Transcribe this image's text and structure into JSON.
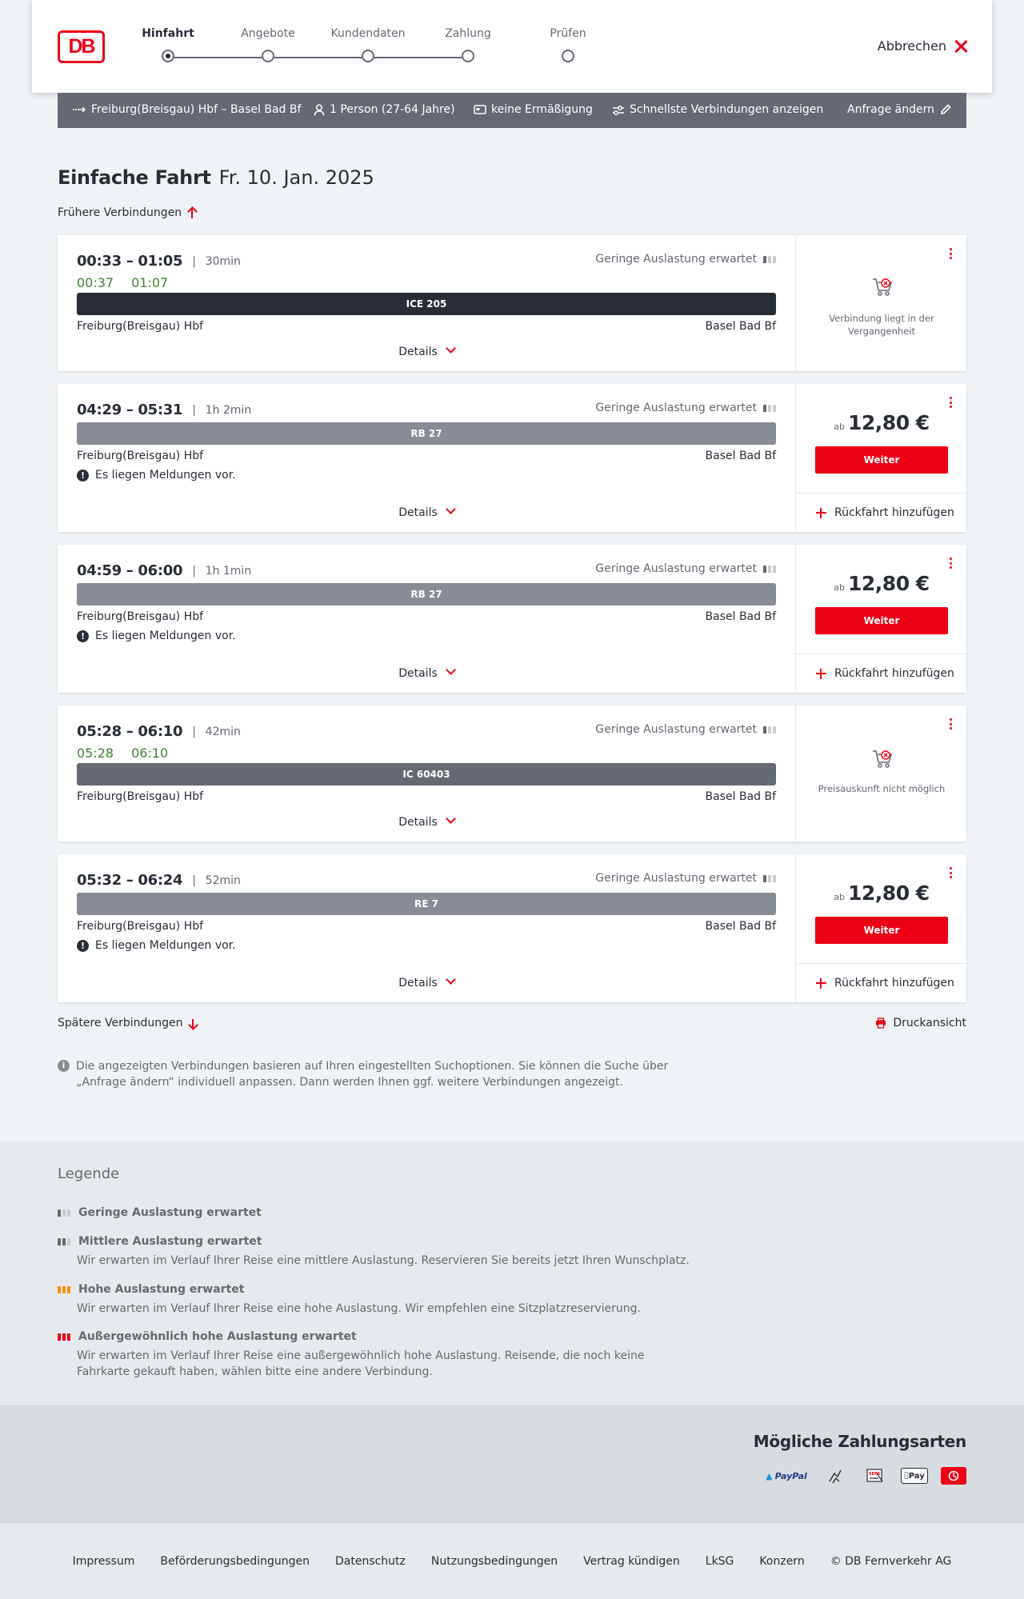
{
  "header": {
    "logo": "DB",
    "steps": [
      "Hinfahrt",
      "Angebote",
      "Kundendaten",
      "Zahlung",
      "Prüfen"
    ],
    "active_step": 0,
    "cancel": "Abbrechen"
  },
  "summary": {
    "route": "Freiburg(Breisgau) Hbf – Basel Bad Bf",
    "travellers": "1 Person (27-64 Jahre)",
    "discount": "keine Ermäßigung",
    "option": "Schnellste Verbindungen anzeigen",
    "edit": "Anfrage ändern"
  },
  "title": {
    "kind": "Einfache Fahrt",
    "date": "Fr. 10. Jan. 2025"
  },
  "earlier": "Frühere Verbindungen",
  "later": "Spätere Verbindungen",
  "print": "Druckansicht",
  "connections": [
    {
      "times": "00:33 – 01:05",
      "duration": "30min",
      "rt_dep": "00:37",
      "rt_arr": "01:07",
      "load": "Geringe Auslastung erwartet",
      "train": "ICE 205",
      "train_color": "#282d37",
      "from": "Freiburg(Breisgau) Hbf",
      "to": "Basel Bad Bf",
      "message": "",
      "details": "Details",
      "status": "Verbindung liegt in der Vergangenheit"
    },
    {
      "times": "04:29 – 05:31",
      "duration": "1h 2min",
      "rt_dep": "",
      "rt_arr": "",
      "load": "Geringe Auslastung erwartet",
      "train": "RB 27",
      "train_color": "#878c96",
      "from": "Freiburg(Breisgau) Hbf",
      "to": "Basel Bad Bf",
      "message": "Es liegen Meldungen vor.",
      "details": "Details",
      "price_prefix": "ab",
      "price": "12,80 €",
      "button": "Weiter",
      "return": "Rückfahrt hinzufügen"
    },
    {
      "times": "04:59 – 06:00",
      "duration": "1h 1min",
      "rt_dep": "",
      "rt_arr": "",
      "load": "Geringe Auslastung erwartet",
      "train": "RB 27",
      "train_color": "#878c96",
      "from": "Freiburg(Breisgau) Hbf",
      "to": "Basel Bad Bf",
      "message": "Es liegen Meldungen vor.",
      "details": "Details",
      "price_prefix": "ab",
      "price": "12,80 €",
      "button": "Weiter",
      "return": "Rückfahrt hinzufügen"
    },
    {
      "times": "05:28 – 06:10",
      "duration": "42min",
      "rt_dep": "05:28",
      "rt_arr": "06:10",
      "load": "Geringe Auslastung erwartet",
      "train": "IC 60403",
      "train_color": "#646973",
      "from": "Freiburg(Breisgau) Hbf",
      "to": "Basel Bad Bf",
      "message": "",
      "details": "Details",
      "status": "Preisauskunft nicht möglich"
    },
    {
      "times": "05:32 – 06:24",
      "duration": "52min",
      "rt_dep": "",
      "rt_arr": "",
      "load": "Geringe Auslastung erwartet",
      "train": "RE 7",
      "train_color": "#878c96",
      "from": "Freiburg(Breisgau) Hbf",
      "to": "Basel Bad Bf",
      "message": "Es liegen Meldungen vor.",
      "details": "Details",
      "price_prefix": "ab",
      "price": "12,80 €",
      "button": "Weiter",
      "return": "Rückfahrt hinzufügen"
    }
  ],
  "info": "Die angezeigten Verbindungen basieren auf Ihren eingestellten Suchoptionen. Sie können die Suche über „Anfrage ändern“ individuell anpassen. Dann werden Ihnen ggf. weitere Verbindungen angezeigt.",
  "legend": {
    "title": "Legende",
    "items": [
      {
        "title": "Geringe Auslastung erwartet",
        "text": ""
      },
      {
        "title": "Mittlere Auslastung erwartet",
        "text": "Wir erwarten im Verlauf Ihrer Reise eine mittlere Auslastung. Reservieren Sie bereits jetzt Ihren Wunschplatz."
      },
      {
        "title": "Hohe Auslastung erwartet",
        "text": "Wir erwarten im Verlauf Ihrer Reise eine hohe Auslastung. Wir empfehlen eine Sitzplatzreservierung."
      },
      {
        "title": "Außergewöhnlich hohe Auslastung erwartet",
        "text": "Wir erwarten im Verlauf Ihrer Reise eine außergewöhnlich hohe Auslastung. Reisende, die noch keine Fahrkarte gekauft haben, wählen bitte eine andere Verbindung."
      }
    ]
  },
  "payment": {
    "title": "Mögliche Zahlungsarten",
    "methods": [
      "PayPal",
      "Pay"
    ],
    "icons": [
      "paypal-icon",
      "lastschrift-icon",
      "sepa-icon",
      "apple-pay-icon",
      "db-creditcard-icon"
    ]
  },
  "footer": [
    "Impressum",
    "Beförderungsbedingungen",
    "Datenschutz",
    "Nutzungsbedingungen",
    "Vertrag kündigen",
    "LkSG",
    "Konzern",
    "© DB Fernverkehr AG"
  ],
  "colors": {
    "accent": "#ec0016",
    "realtime": "#408335",
    "dark": "#282d37",
    "bar": "#646973"
  }
}
